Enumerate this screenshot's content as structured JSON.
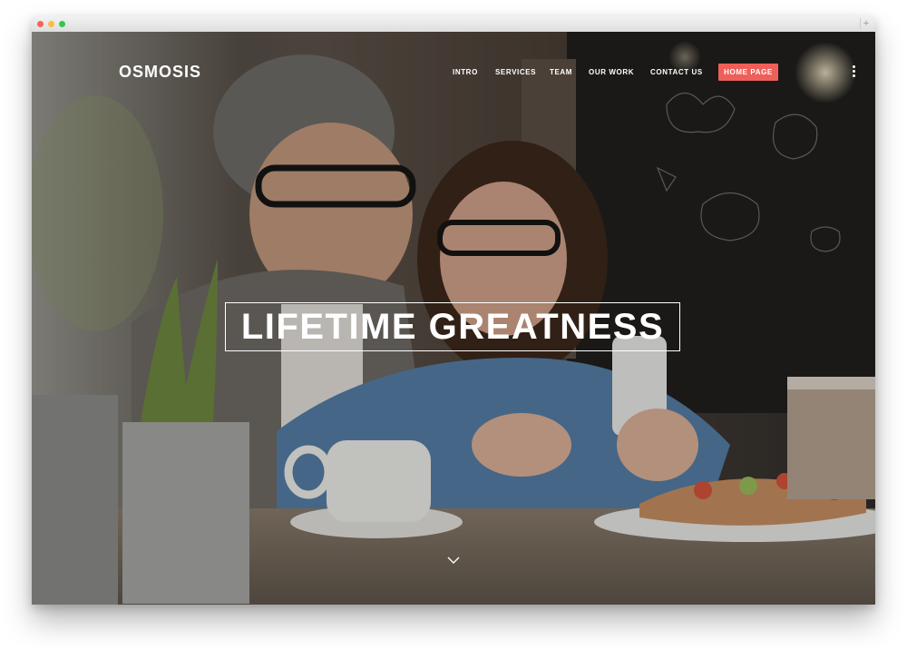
{
  "browser": {
    "new_tab_symbol": "+"
  },
  "site": {
    "logo": "OSMOSIS",
    "nav": [
      "INTRO",
      "SERVICES",
      "TEAM",
      "OUR WORK",
      "CONTACT US"
    ],
    "cta_label": "HOME PAGE",
    "headline": "LIFETIME GREATNESS"
  },
  "colors": {
    "accent": "#ef5f5a",
    "text": "#ffffff"
  },
  "icons": {
    "menu": "kebab-menu-icon",
    "scroll": "chevron-down-icon"
  }
}
